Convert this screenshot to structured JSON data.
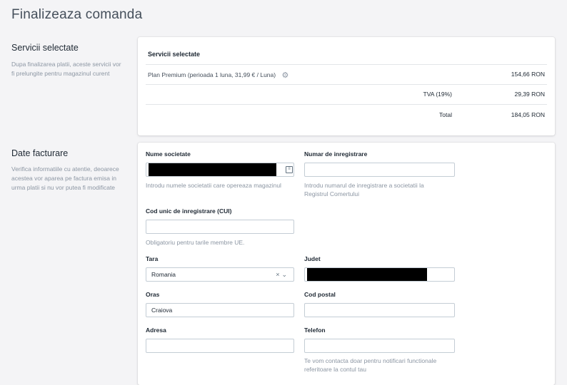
{
  "page": {
    "title": "Finalizeaza comanda"
  },
  "services_section": {
    "title": "Servicii selectate",
    "description": "Dupa finalizarea platii, aceste servicii vor fi prelungite pentru magazinul curent",
    "card_header": "Servicii selectate",
    "items": [
      {
        "label": "Plan Premium (perioada 1 luna, 31,99 € / Luna)",
        "amount": "154,66 RON"
      }
    ],
    "vat_label": "TVA (19%)",
    "vat_amount": "29,39 RON",
    "total_label": "Total",
    "total_amount": "184,05 RON"
  },
  "billing_section": {
    "title": "Date facturare",
    "description": "Verifica informatiile cu atentie, deoarece acestea vor aparea pe factura emisa in urma platii si nu vor putea fi modificate",
    "company": {
      "label": "Nume societate",
      "value": "",
      "help": "Introdu numele societatii care opereaza magazinul"
    },
    "reg_number": {
      "label": "Numar de inregistrare",
      "value": "",
      "help": "Introdu numarul de inregistrare a societatii la Registrul Comertului"
    },
    "cui": {
      "label": "Cod unic de inregistrare (CUI)",
      "value": "",
      "help": "Obligatoriu pentru tarile membre UE."
    },
    "country": {
      "label": "Tara",
      "value": "Romania",
      "clear": "×",
      "caret": "⌄"
    },
    "county": {
      "label": "Judet",
      "value": ""
    },
    "city": {
      "label": "Oras",
      "value": "Craiova"
    },
    "postal_code": {
      "label": "Cod postal",
      "value": ""
    },
    "address": {
      "label": "Adresa",
      "value": ""
    },
    "phone": {
      "label": "Telefon",
      "value": "",
      "help": "Te vom contacta doar pentru notificari functionale referitoare la contul tau"
    }
  },
  "icons": {
    "settings": "gear-icon",
    "autofill": "contact-card-icon"
  },
  "colors": {
    "background": "#f4f4f6",
    "card": "#ffffff",
    "border": "#c4cdd5",
    "muted_text": "#8c96a3"
  }
}
